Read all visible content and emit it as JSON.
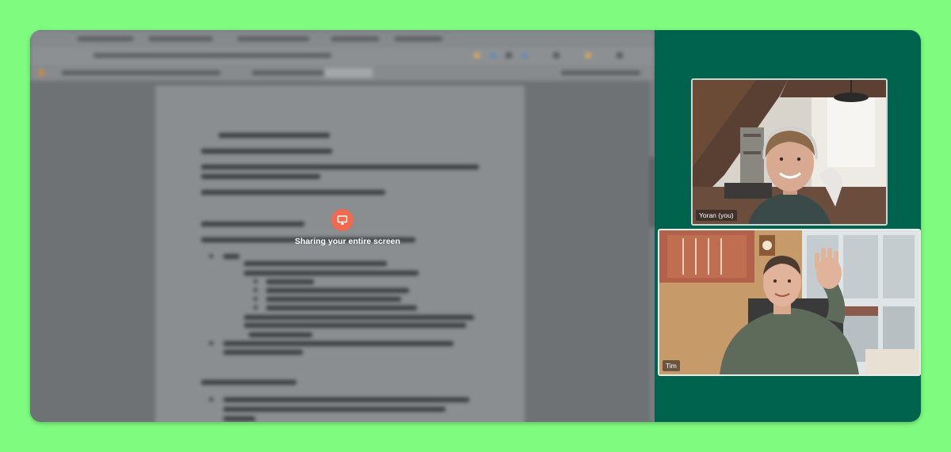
{
  "screen_share": {
    "status_text": "Sharing your entire screen",
    "icon": "screen-share-icon",
    "accent_color": "#ef6a4f"
  },
  "participants": [
    {
      "name": "Yoran (you)",
      "is_self": true
    },
    {
      "name": "Tim",
      "is_self": false
    }
  ],
  "colors": {
    "background": "#7ffc7f",
    "panel": "#00634e"
  }
}
